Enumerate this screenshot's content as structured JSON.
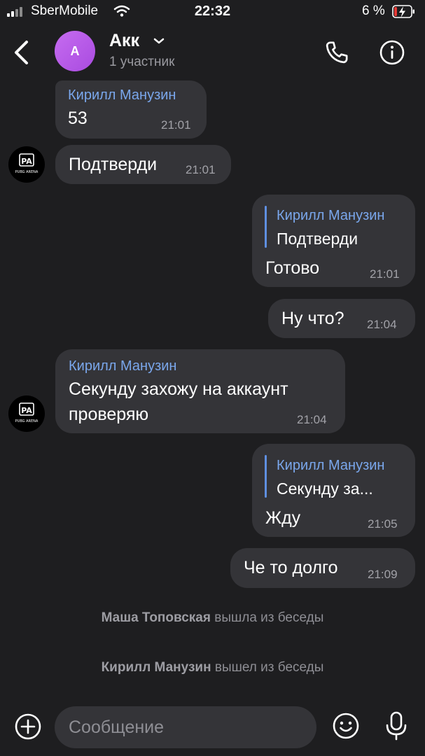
{
  "status_bar": {
    "carrier": "SberMobile",
    "time": "22:32",
    "battery": "6 %"
  },
  "header": {
    "avatar_letter": "A",
    "title": "Акк",
    "subtitle": "1 участник"
  },
  "mini_avatar_text": {
    "top": "PA",
    "bottom": "PUBG ARENA"
  },
  "messages": [
    {
      "sender": "Кирилл Манузин",
      "text": "53",
      "time": "21:01"
    },
    {
      "text": "Подтверди",
      "time": "21:01"
    },
    {
      "quote_sender": "Кирилл Манузин",
      "quote_text": "Подтверди",
      "text": "Готово",
      "time": "21:01"
    },
    {
      "text": "Ну что?",
      "time": "21:04"
    },
    {
      "sender": "Кирилл Манузин",
      "line1": "Секунду захожу на аккаунт",
      "line2": "проверяю",
      "time": "21:04"
    },
    {
      "quote_sender": "Кирилл Манузин",
      "quote_text": "Секунду за...",
      "text": "Жду",
      "time": "21:05"
    },
    {
      "text": "Че то долго",
      "time": "21:09"
    }
  ],
  "system": [
    {
      "name": "Маша Топовская",
      "action": "вышла из беседы"
    },
    {
      "name": "Кирилл Манузин",
      "action": "вышел из беседы"
    }
  ],
  "composer": {
    "placeholder": "Сообщение"
  },
  "colors": {
    "background": "#1e1e20",
    "bubble": "#343438",
    "accent": "#7aa7ec",
    "avatar": "#b85ce8"
  }
}
